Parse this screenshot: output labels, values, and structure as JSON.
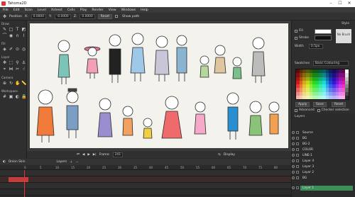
{
  "window": {
    "title": "Tahoma2D",
    "minimize_glyph": "–",
    "maximize_glyph": "☐",
    "close_glyph": "✕"
  },
  "menu": [
    "File",
    "Edit",
    "Scan",
    "Level",
    "Xsheet",
    "Cells",
    "Play",
    "Render",
    "View",
    "Windows",
    "Help"
  ],
  "tool_options": {
    "mode_label": "Position",
    "x_label": "X:",
    "x_value": "0.0000",
    "y_label": "Y:",
    "y_value": "-0.0000",
    "z_label": "Z:",
    "z_value": "0.0000",
    "reset_label": "Reset",
    "show_path_label": "Show path"
  },
  "toolbox": {
    "sections": [
      "Draw",
      "Fill",
      "Layer",
      "Camera",
      "Workspace"
    ]
  },
  "viewer": {
    "frame_label": "Frame:",
    "frame_value": "241",
    "display_label": "Display"
  },
  "style": {
    "title": "Style",
    "fill_label": "Fill",
    "stroke_label": "Stroke",
    "width_label": "Width",
    "width_value": "0.5px",
    "no_brush_label": "No Brush",
    "swatches_label": "Swatches",
    "palette_name": "Basic Colouring",
    "apply_label": "Apply",
    "save_label": "Save",
    "reset_label": "Reset",
    "advanced_label": "Advanced",
    "checker_label": "Checker selection",
    "stroke_color": "#111111",
    "fill_color": "#ffffff"
  },
  "layers": {
    "title": "Layers",
    "items": [
      "Source",
      "BG",
      "BG-2",
      "COLOR",
      "LINE-1",
      "Layer 4",
      "Layer 3",
      "Layer 2",
      "BG",
      "Layer 1"
    ]
  },
  "timeline": {
    "ticks": [
      "0",
      "5",
      "10",
      "15",
      "20",
      "25",
      "30",
      "35",
      "40",
      "45",
      "50",
      "55",
      "60",
      "65",
      "70",
      "75",
      "80"
    ],
    "onion_label": "Onion Skin",
    "layers_label": "Layers"
  },
  "colors": {
    "accent": "#e2333a",
    "selection": "#3d8f5a",
    "panel": "#2e2e2e"
  }
}
